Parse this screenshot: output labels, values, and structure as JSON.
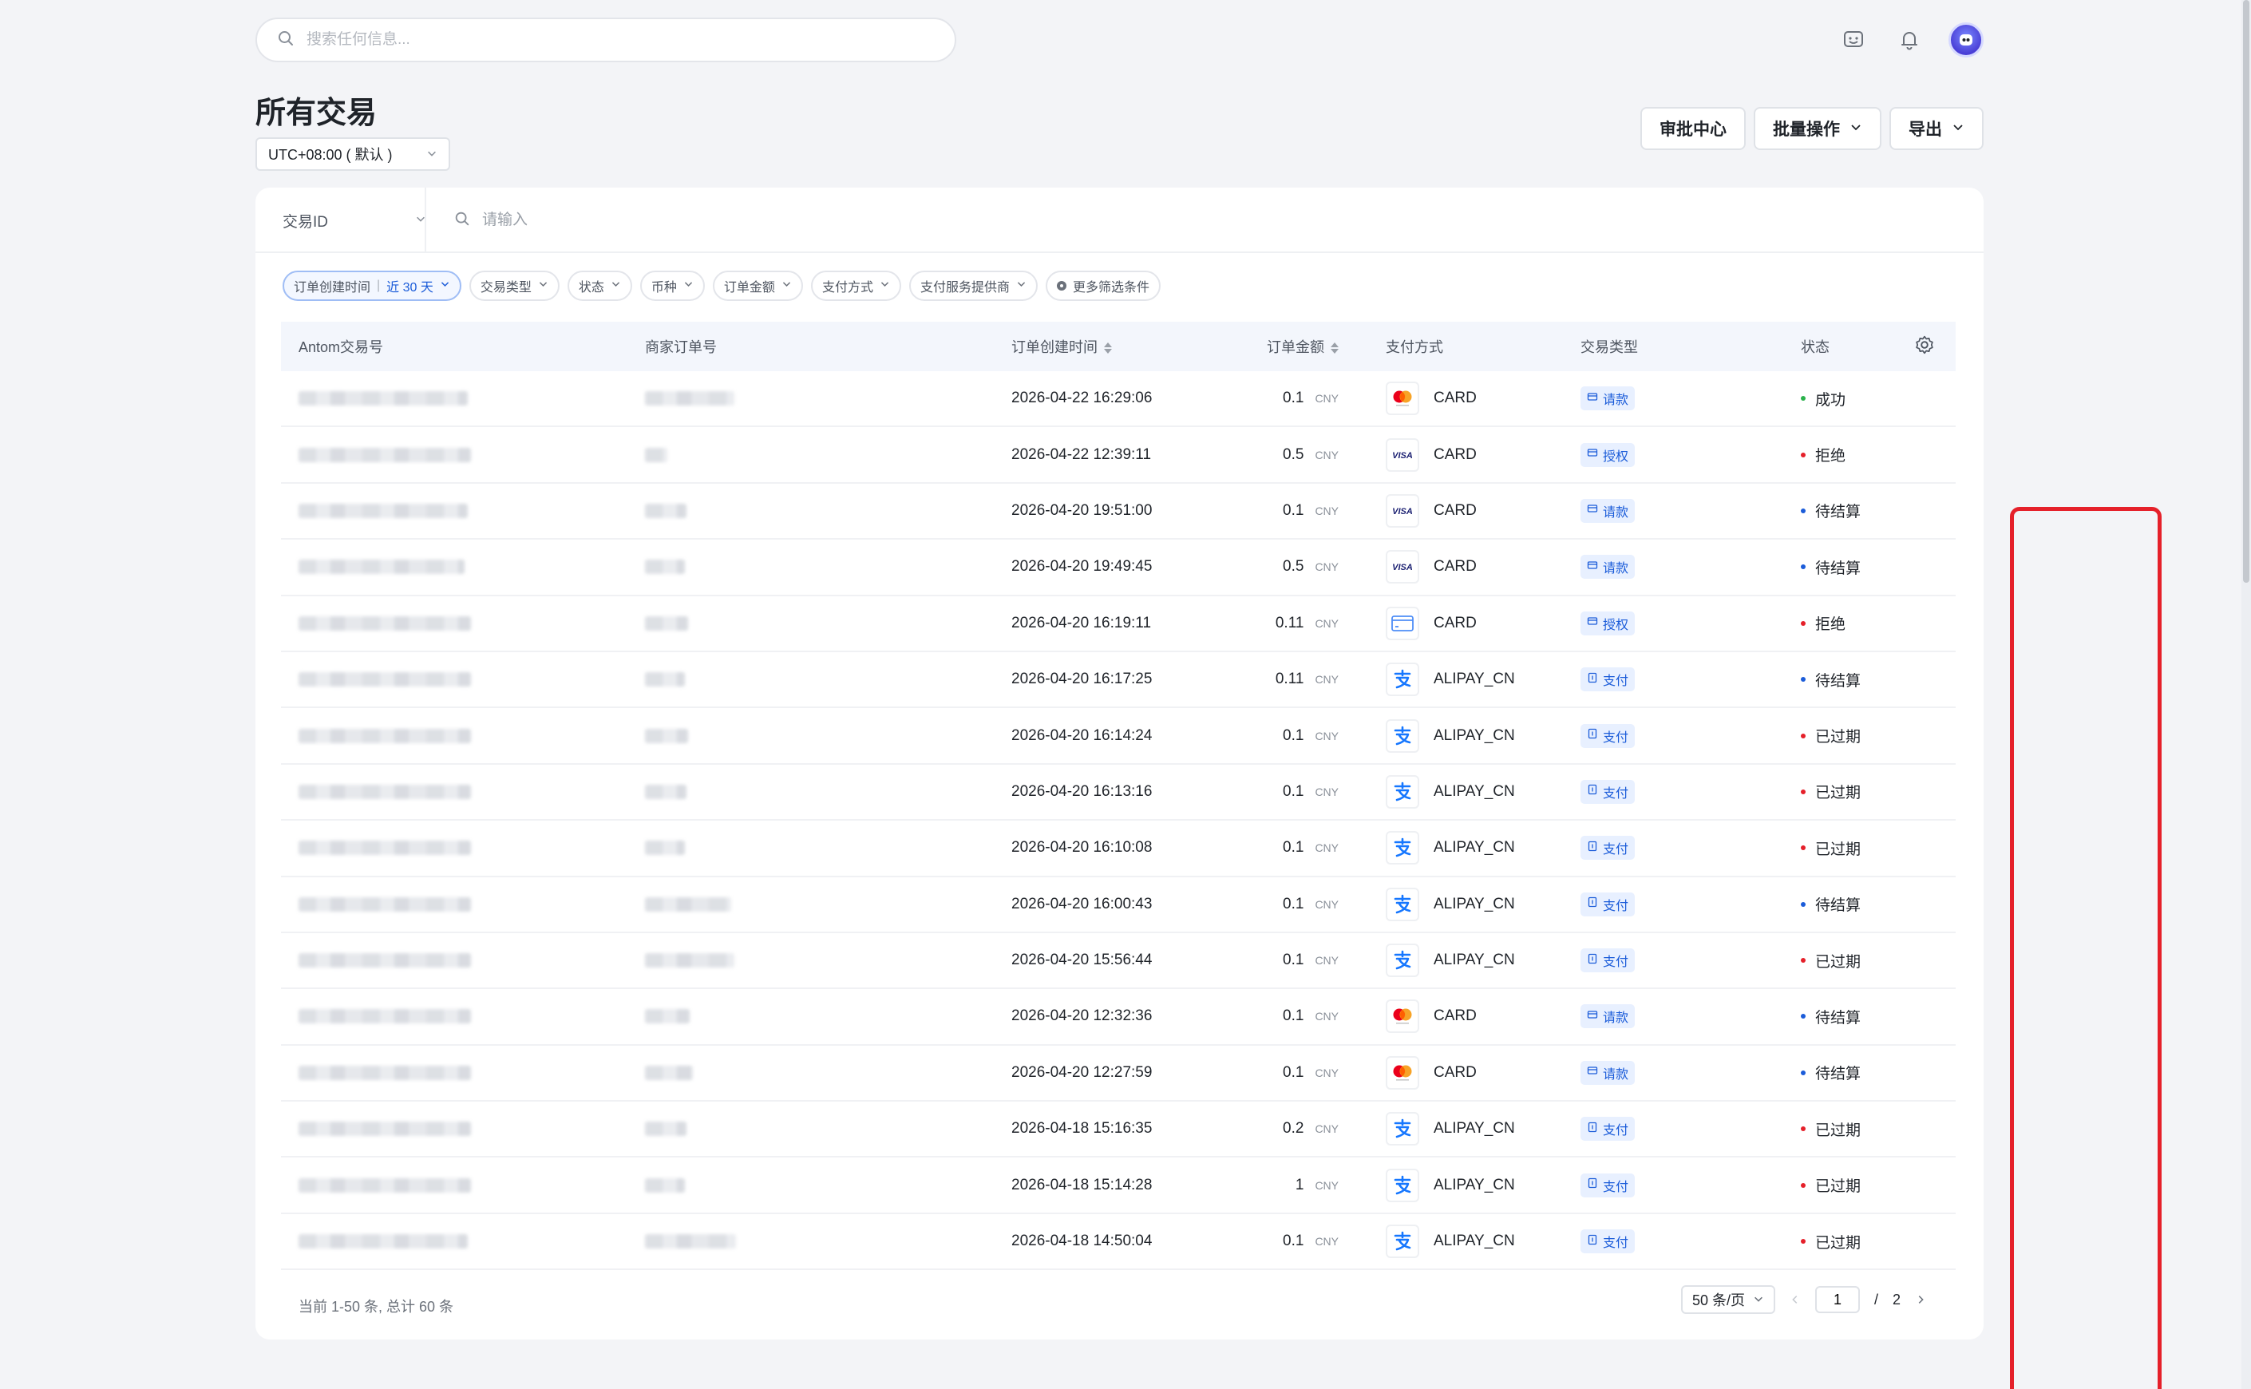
{
  "search": {
    "placeholder": "搜索任何信息..."
  },
  "header": {
    "title": "所有交易",
    "timezone": "UTC+08:00 ( 默认 )",
    "actions": {
      "approval": "审批中心",
      "batch": "批量操作",
      "export": "导出"
    }
  },
  "filter": {
    "id_field": "交易ID",
    "id_placeholder": "请输入",
    "chips": {
      "created_label": "订单创建时间",
      "created_sep": "|",
      "created_value": "近 30 天",
      "type": "交易类型",
      "status": "状态",
      "currency": "币种",
      "amount": "订单金额",
      "method": "支付方式",
      "provider": "支付服务提供商",
      "more": "更多筛选条件"
    }
  },
  "table": {
    "columns": {
      "antom_id": "Antom交易号",
      "merchant_order": "商家订单号",
      "created": "订单创建时间",
      "amount": "订单金额",
      "method": "支付方式",
      "type": "交易类型",
      "status": "状态"
    },
    "rows": [
      {
        "time": "2026-04-22 16:29:06",
        "amount": "0.1",
        "currency": "CNY",
        "method_icon": "mastercard-icon",
        "method": "CARD",
        "type": "请款",
        "status": "成功",
        "status_color": "#2bb24c"
      },
      {
        "time": "2026-04-22 12:39:11",
        "amount": "0.5",
        "currency": "CNY",
        "method_icon": "visa-icon",
        "method": "CARD",
        "type": "授权",
        "status": "拒绝",
        "status_color": "#e5202a"
      },
      {
        "time": "2026-04-20 19:51:00",
        "amount": "0.1",
        "currency": "CNY",
        "method_icon": "visa-icon",
        "method": "CARD",
        "type": "请款",
        "status": "待结算",
        "status_color": "#1b5cd9"
      },
      {
        "time": "2026-04-20 19:49:45",
        "amount": "0.5",
        "currency": "CNY",
        "method_icon": "visa-icon",
        "method": "CARD",
        "type": "请款",
        "status": "待结算",
        "status_color": "#1b5cd9"
      },
      {
        "time": "2026-04-20 16:19:11",
        "amount": "0.11",
        "currency": "CNY",
        "method_icon": "generic-card-icon",
        "method": "CARD",
        "type": "授权",
        "status": "拒绝",
        "status_color": "#e5202a"
      },
      {
        "time": "2026-04-20 16:17:25",
        "amount": "0.11",
        "currency": "CNY",
        "method_icon": "alipay-icon",
        "method": "ALIPAY_CN",
        "type": "支付",
        "status": "待结算",
        "status_color": "#1b5cd9"
      },
      {
        "time": "2026-04-20 16:14:24",
        "amount": "0.1",
        "currency": "CNY",
        "method_icon": "alipay-icon",
        "method": "ALIPAY_CN",
        "type": "支付",
        "status": "已过期",
        "status_color": "#e5202a"
      },
      {
        "time": "2026-04-20 16:13:16",
        "amount": "0.1",
        "currency": "CNY",
        "method_icon": "alipay-icon",
        "method": "ALIPAY_CN",
        "type": "支付",
        "status": "已过期",
        "status_color": "#e5202a"
      },
      {
        "time": "2026-04-20 16:10:08",
        "amount": "0.1",
        "currency": "CNY",
        "method_icon": "alipay-icon",
        "method": "ALIPAY_CN",
        "type": "支付",
        "status": "已过期",
        "status_color": "#e5202a"
      },
      {
        "time": "2026-04-20 16:00:43",
        "amount": "0.1",
        "currency": "CNY",
        "method_icon": "alipay-icon",
        "method": "ALIPAY_CN",
        "type": "支付",
        "status": "待结算",
        "status_color": "#1b5cd9"
      },
      {
        "time": "2026-04-20 15:56:44",
        "amount": "0.1",
        "currency": "CNY",
        "method_icon": "alipay-icon",
        "method": "ALIPAY_CN",
        "type": "支付",
        "status": "已过期",
        "status_color": "#e5202a"
      },
      {
        "time": "2026-04-20 12:32:36",
        "amount": "0.1",
        "currency": "CNY",
        "method_icon": "mastercard-icon",
        "method": "CARD",
        "type": "请款",
        "status": "待结算",
        "status_color": "#1b5cd9"
      },
      {
        "time": "2026-04-20 12:27:59",
        "amount": "0.1",
        "currency": "CNY",
        "method_icon": "mastercard-icon",
        "method": "CARD",
        "type": "请款",
        "status": "待结算",
        "status_color": "#1b5cd9"
      },
      {
        "time": "2026-04-18 15:16:35",
        "amount": "0.2",
        "currency": "CNY",
        "method_icon": "alipay-icon",
        "method": "ALIPAY_CN",
        "type": "支付",
        "status": "已过期",
        "status_color": "#e5202a"
      },
      {
        "time": "2026-04-18 15:14:28",
        "amount": "1",
        "currency": "CNY",
        "method_icon": "alipay-icon",
        "method": "ALIPAY_CN",
        "type": "支付",
        "status": "已过期",
        "status_color": "#e5202a"
      },
      {
        "time": "2026-04-18 14:50:04",
        "amount": "0.1",
        "currency": "CNY",
        "method_icon": "alipay-icon",
        "method": "ALIPAY_CN",
        "type": "支付",
        "status": "已过期",
        "status_color": "#e5202a"
      }
    ]
  },
  "footer": {
    "summary": "当前 1-50 条, 总计 60 条",
    "page_size": "50 条/页",
    "current_page": "1",
    "separator": "/",
    "total_pages": "2"
  },
  "highlight_color": "#e5202a"
}
